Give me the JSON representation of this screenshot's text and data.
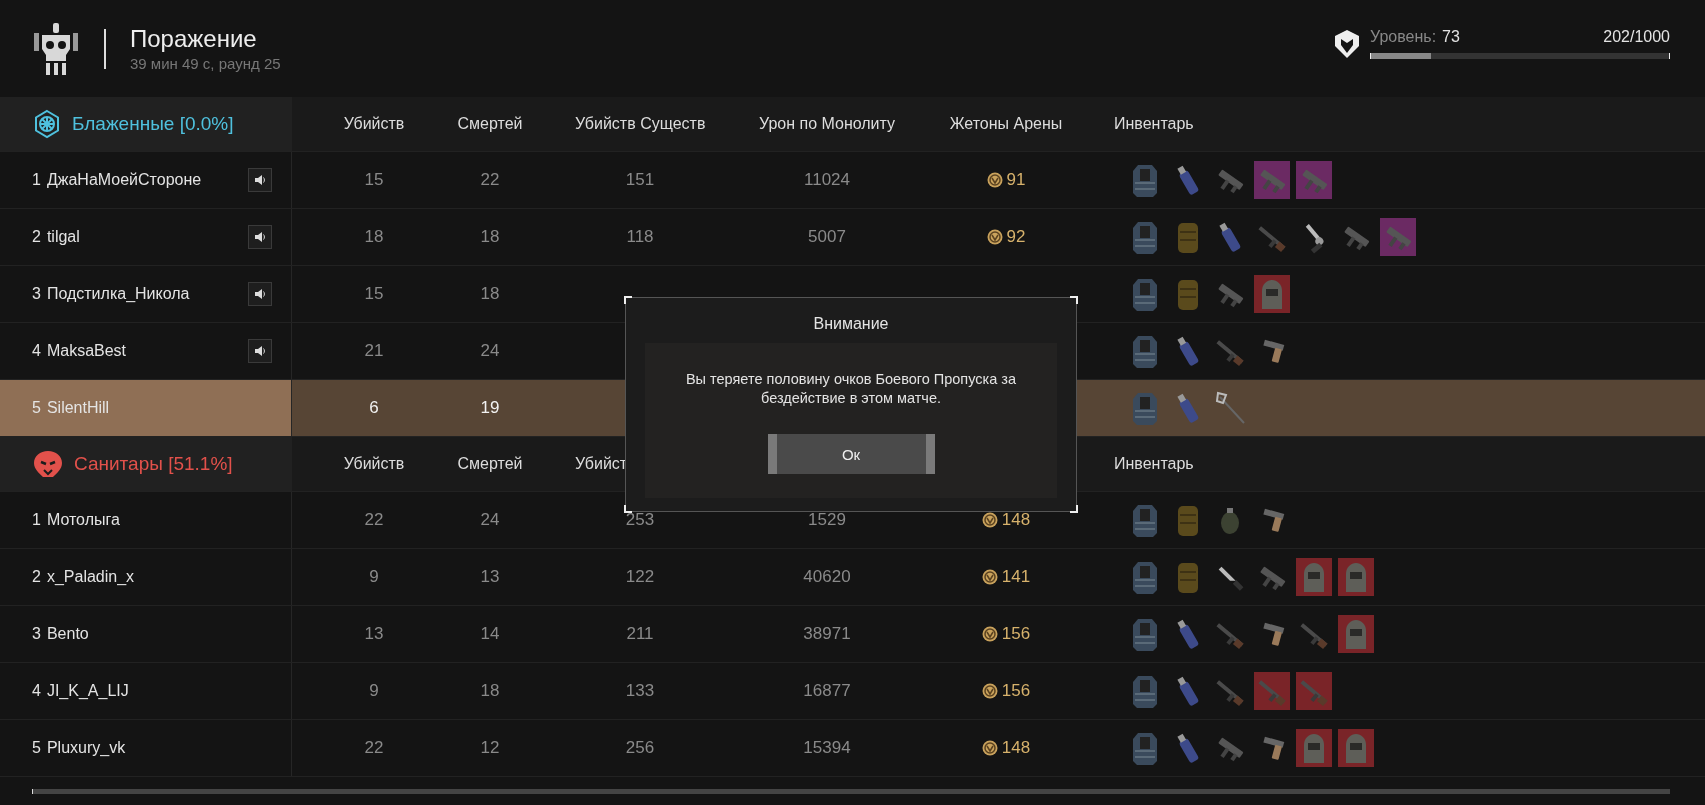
{
  "header": {
    "title": "Поражение",
    "subtitle": "39 мин 49 с, раунд 25",
    "level_label": "Уровень:",
    "level_value": "73",
    "progress_text": "202/1000",
    "level": 0.202
  },
  "teams": [
    {
      "name": "Блаженные [0.0%]",
      "kind": "blessed",
      "color": "#4fc1de",
      "columns": [
        "Убийств",
        "Смертей",
        "Убийств Существ",
        "Урон по Монолиту",
        "Жетоны Арены",
        "Инвентарь"
      ],
      "players": [
        {
          "rank": "1",
          "name": "ДжаНаМоейСтороне",
          "voice": true,
          "selected": false,
          "kills": "15",
          "deaths": "22",
          "creature_kills": "151",
          "monolith_damage": "11024",
          "tokens": "91",
          "inventory": [
            {
              "kind": "armor"
            },
            {
              "kind": "canister"
            },
            {
              "kind": "smg"
            },
            {
              "kind": "smg",
              "color": "#6b2a63"
            },
            {
              "kind": "smg",
              "color": "#6b2a63"
            }
          ]
        },
        {
          "rank": "2",
          "name": "tilgal",
          "voice": true,
          "selected": false,
          "kills": "18",
          "deaths": "18",
          "creature_kills": "118",
          "monolith_damage": "5007",
          "tokens": "92",
          "inventory": [
            {
              "kind": "armor"
            },
            {
              "kind": "backpack"
            },
            {
              "kind": "canister"
            },
            {
              "kind": "rifle"
            },
            {
              "kind": "revolver"
            },
            {
              "kind": "smg"
            },
            {
              "kind": "smg",
              "color": "#6b2a63"
            }
          ]
        },
        {
          "rank": "3",
          "name": "Подстилка_Никола",
          "voice": true,
          "selected": false,
          "kills": "15",
          "deaths": "18",
          "inventory": [
            {
              "kind": "armor"
            },
            {
              "kind": "backpack"
            },
            {
              "kind": "smg"
            },
            {
              "kind": "helmet",
              "color": "#7a2428"
            }
          ]
        },
        {
          "rank": "4",
          "name": "MaksaBest",
          "voice": true,
          "selected": false,
          "kills": "21",
          "deaths": "24",
          "inventory": [
            {
              "kind": "armor"
            },
            {
              "kind": "canister"
            },
            {
              "kind": "rifle"
            },
            {
              "kind": "pistol"
            }
          ]
        },
        {
          "rank": "5",
          "name": "SilentHill",
          "voice": false,
          "selected": true,
          "kills": "6",
          "deaths": "19",
          "inventory": [
            {
              "kind": "armor"
            },
            {
              "kind": "canister"
            },
            {
              "kind": "axe"
            }
          ]
        }
      ]
    },
    {
      "name": "Санитары [51.1%]",
      "kind": "sanitar",
      "color": "#e2514b",
      "columns": [
        "Убийств",
        "Смертей",
        "Убийст",
        null,
        null,
        "Инвентарь"
      ],
      "players": [
        {
          "rank": "1",
          "name": "Мотолыга",
          "voice": false,
          "selected": false,
          "kills": "22",
          "deaths": "24",
          "creature_kills": "253",
          "monolith_damage": "1529",
          "tokens": "148",
          "inventory": [
            {
              "kind": "armor"
            },
            {
              "kind": "backpack"
            },
            {
              "kind": "grenade"
            },
            {
              "kind": "pistol"
            }
          ]
        },
        {
          "rank": "2",
          "name": "x_Paladin_x",
          "voice": false,
          "selected": false,
          "kills": "9",
          "deaths": "13",
          "creature_kills": "122",
          "monolith_damage": "40620",
          "tokens": "141",
          "inventory": [
            {
              "kind": "armor"
            },
            {
              "kind": "backpack"
            },
            {
              "kind": "knife"
            },
            {
              "kind": "smg"
            },
            {
              "kind": "helmet",
              "color": "#7a2428"
            },
            {
              "kind": "helmet",
              "color": "#7a2428"
            }
          ]
        },
        {
          "rank": "3",
          "name": "Bento",
          "voice": false,
          "selected": false,
          "kills": "13",
          "deaths": "14",
          "creature_kills": "211",
          "monolith_damage": "38971",
          "tokens": "156",
          "inventory": [
            {
              "kind": "armor"
            },
            {
              "kind": "canister"
            },
            {
              "kind": "rifle"
            },
            {
              "kind": "pistol"
            },
            {
              "kind": "rifle"
            },
            {
              "kind": "helmet",
              "color": "#7a2428"
            }
          ]
        },
        {
          "rank": "4",
          "name": "JI_K_A_LIJ",
          "voice": false,
          "selected": false,
          "kills": "9",
          "deaths": "18",
          "creature_kills": "133",
          "monolith_damage": "16877",
          "tokens": "156",
          "inventory": [
            {
              "kind": "armor"
            },
            {
              "kind": "canister"
            },
            {
              "kind": "rifle"
            },
            {
              "kind": "rifle",
              "color": "#7a2428"
            },
            {
              "kind": "rifle",
              "color": "#7a2428"
            }
          ]
        },
        {
          "rank": "5",
          "name": "Pluxury_vk",
          "voice": false,
          "selected": false,
          "kills": "22",
          "deaths": "12",
          "creature_kills": "256",
          "monolith_damage": "15394",
          "tokens": "148",
          "inventory": [
            {
              "kind": "armor"
            },
            {
              "kind": "canister"
            },
            {
              "kind": "smg"
            },
            {
              "kind": "pistol"
            },
            {
              "kind": "helmet",
              "color": "#7a2428"
            },
            {
              "kind": "helmet",
              "color": "#7a2428"
            }
          ]
        }
      ]
    }
  ],
  "dialog": {
    "title": "Внимание",
    "message": "Вы теряете половину очков Боевого Пропуска за бездействие в этом матче.",
    "button": "Ок"
  }
}
